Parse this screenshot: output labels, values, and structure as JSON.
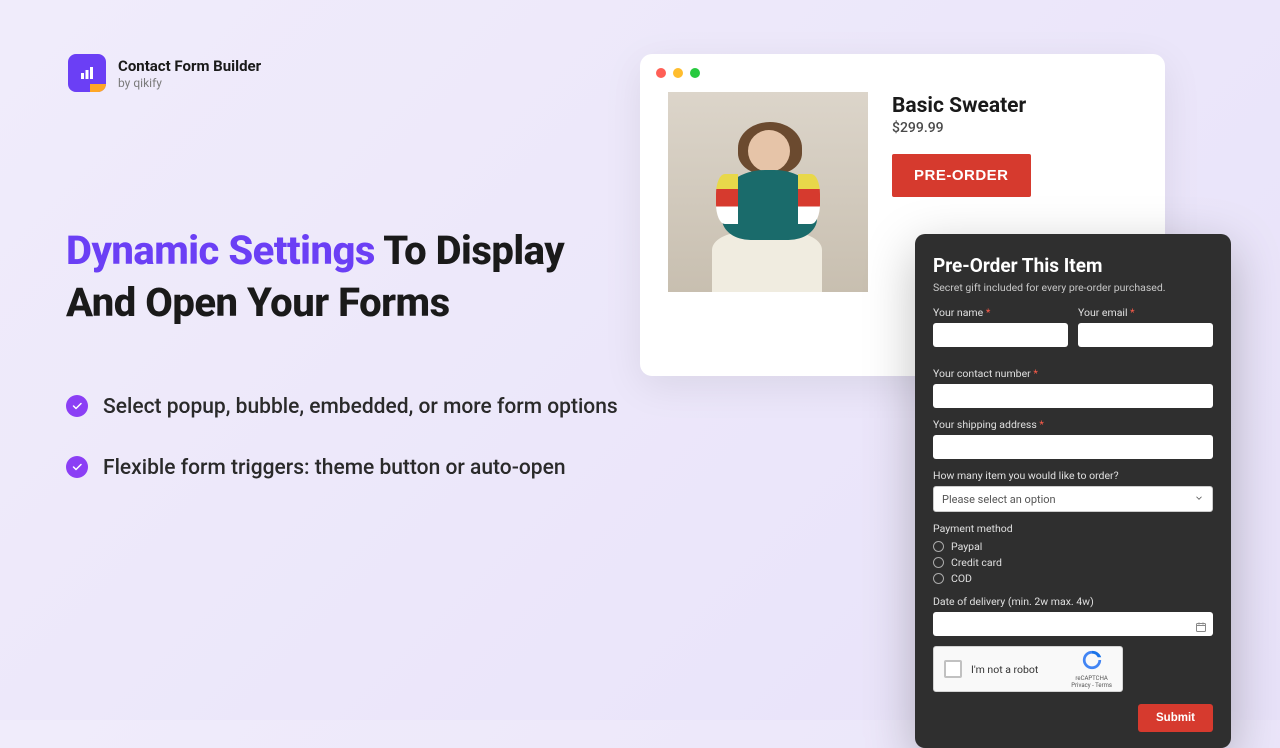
{
  "header": {
    "app_title": "Contact Form Builder",
    "app_subtitle": "by qikify"
  },
  "hero": {
    "title_accent": "Dynamic Settings",
    "title_rest": " To Display And Open Your Forms"
  },
  "bullets": [
    "Select popup, bubble, embedded, or more form options",
    "Flexible form triggers: theme button or auto-open"
  ],
  "product": {
    "name": "Basic Sweater",
    "price": "$299.99",
    "button": "PRE-ORDER"
  },
  "form": {
    "title": "Pre-Order This Item",
    "subtitle": "Secret gift included for every pre-order purchased.",
    "fields": {
      "name_label": "Your name",
      "email_label": "Your email",
      "contact_label": "Your contact number",
      "address_label": "Your shipping address",
      "qty_label": "How many item you would like to order?",
      "qty_placeholder": "Please select an option",
      "payment_label": "Payment method",
      "payment_options": [
        "Paypal",
        "Credit card",
        "COD"
      ],
      "date_label": "Date of delivery (min. 2w max. 4w)"
    },
    "recaptcha": {
      "text": "I'm not a robot",
      "brand": "reCAPTCHA",
      "terms": "Privacy - Terms"
    },
    "submit": "Submit"
  },
  "colors": {
    "accent": "#6b3ff5",
    "danger": "#d63a2e",
    "check": "#8b3ff5"
  }
}
